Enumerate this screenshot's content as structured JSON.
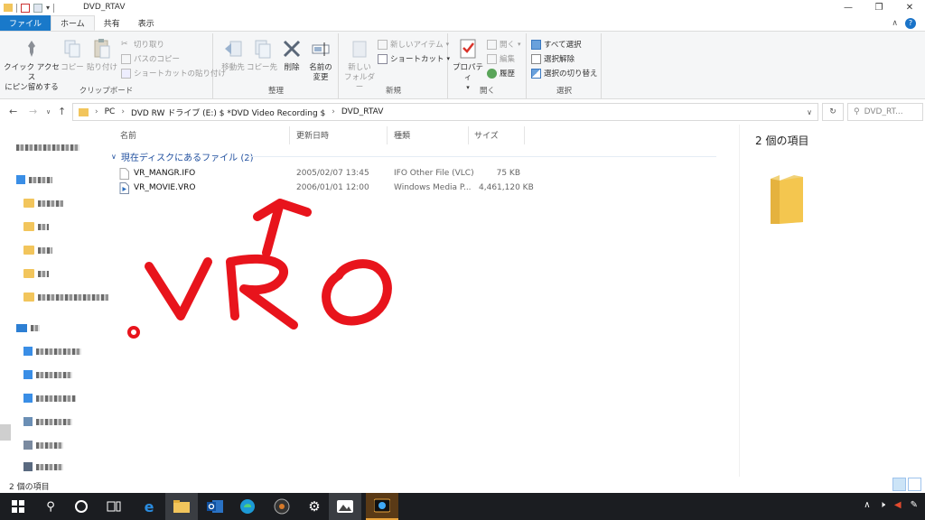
{
  "window": {
    "title": "DVD_RTAV",
    "minimize": "—",
    "maximize": "❐",
    "close": "✕"
  },
  "ribbon_tabs": {
    "file": "ファイル",
    "home": "ホーム",
    "share": "共有",
    "view": "表示"
  },
  "ribbon": {
    "clipboard": {
      "label": "クリップボード",
      "pin_line1": "クイック アクセス",
      "pin_line2": "にピン留めする",
      "copy": "コピー",
      "paste": "貼り付け",
      "cut": "切り取り",
      "copy_path": "パスのコピー",
      "paste_shortcut": "ショートカットの貼り付け"
    },
    "organize": {
      "label": "整理",
      "move_to": "移動先",
      "copy_to": "コピー先",
      "delete": "削除",
      "rename_line1": "名前の",
      "rename_line2": "変更"
    },
    "new": {
      "label": "新規",
      "new_folder_line1": "新しい",
      "new_folder_line2": "フォルダー",
      "new_item": "新しいアイテム",
      "shortcut": "ショートカット"
    },
    "open": {
      "label": "開く",
      "properties": "プロパティ",
      "open": "開く",
      "edit": "編集",
      "history": "履歴"
    },
    "select": {
      "label": "選択",
      "select_all": "すべて選択",
      "select_none": "選択解除",
      "invert": "選択の切り替え"
    }
  },
  "address": {
    "path": [
      "PC",
      "DVD RW ドライブ (E:) $ *DVD Video Recording $",
      "DVD_RTAV"
    ],
    "search_placeholder": "DVD_RT..."
  },
  "columns": {
    "name": "名前",
    "date": "更新日時",
    "type": "種類",
    "size": "サイズ"
  },
  "group": {
    "label": "現在ディスクにあるファイル (2)"
  },
  "files": [
    {
      "name": "VR_MANGR.IFO",
      "date": "2005/02/07 13:45",
      "type": "IFO Other File (VLC)",
      "size": "75 KB"
    },
    {
      "name": "VR_MOVIE.VRO",
      "date": "2006/01/01 12:00",
      "type": "Windows Media P...",
      "size": "4,461,120 KB"
    }
  ],
  "preview": {
    "count": "2 個の項目"
  },
  "status": {
    "count": "2 個の項目"
  },
  "annotation": {
    "handwritten_text": ".VRO",
    "color": "#e8141c"
  },
  "colors": {
    "file_tab": "#1979ca",
    "folder": "#f2c55c",
    "group_header": "#1e4e9e",
    "taskbar": "#1b1d21"
  },
  "taskbar_icons": [
    "windows-start-icon",
    "search-icon",
    "cortana-icon",
    "task-view-icon",
    "edge-legacy-icon",
    "file-explorer-icon",
    "outlook-icon",
    "edge-icon",
    "media-player-icon",
    "settings-icon",
    "photos-icon",
    "app-icon"
  ]
}
